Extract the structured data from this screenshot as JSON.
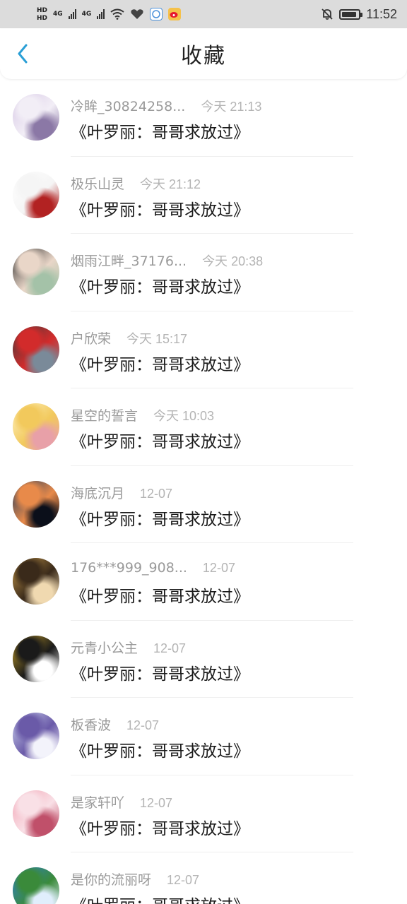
{
  "status_bar": {
    "hd1": "HD",
    "hd2": "HD",
    "net1": "4G",
    "net2": "4G",
    "time": "11:52",
    "icons": [
      "hd-icon",
      "signal-icon",
      "wifi-icon",
      "heart-app-icon",
      "chat-app-icon",
      "weibo-icon",
      "mute-icon",
      "battery-icon"
    ],
    "battery_level": 0.9
  },
  "nav": {
    "title": "收藏",
    "back_icon": "chevron-left-icon",
    "accent": "#2a9fd6"
  },
  "favorites": [
    {
      "user": "冷眸_30824258...",
      "time": "今天 21:13",
      "content": "《叶罗丽：哥哥求放过》",
      "avatar": [
        "#d8c9e6",
        "#f2eef6",
        "#8b78a6"
      ]
    },
    {
      "user": "极乐山灵",
      "time": "今天 21:12",
      "content": "《叶罗丽：哥哥求放过》",
      "avatar": [
        "#ffffff",
        "#f5f5f5",
        "#b22222"
      ]
    },
    {
      "user": "烟雨江畔_37176...",
      "time": "今天 20:38",
      "content": "《叶罗丽：哥哥求放过》",
      "avatar": [
        "#2b2b2b",
        "#e9d6c8",
        "#a4c2a8"
      ]
    },
    {
      "user": "户欣荣",
      "time": "今天 15:17",
      "content": "《叶罗丽：哥哥求放过》",
      "avatar": [
        "#3b3b3b",
        "#d22b2b",
        "#7a8a99"
      ]
    },
    {
      "user": "星空的誓言",
      "time": "今天 10:03",
      "content": "《叶罗丽：哥哥求放过》",
      "avatar": [
        "#fff3c4",
        "#f2c95c",
        "#e8a0a8"
      ]
    },
    {
      "user": "海底沉月",
      "time": "12-07",
      "content": "《叶罗丽：哥哥求放过》",
      "avatar": [
        "#1c3a5e",
        "#e88a4a",
        "#0b0f1a"
      ]
    },
    {
      "user": "176***999_908...",
      "time": "12-07",
      "content": "《叶罗丽：哥哥求放过》",
      "avatar": [
        "#c79a4a",
        "#3a2a1a",
        "#f0d9b0"
      ]
    },
    {
      "user": "元青小公主",
      "time": "12-07",
      "content": "《叶罗丽：哥哥求放过》",
      "avatar": [
        "#c9a227",
        "#1a1a1a",
        "#ffffff"
      ]
    },
    {
      "user": "板香波",
      "time": "12-07",
      "content": "《叶罗丽：哥哥求放过》",
      "avatar": [
        "#cfd8f0",
        "#6a5aa8",
        "#f3f3fb"
      ]
    },
    {
      "user": "是家轩吖",
      "time": "12-07",
      "content": "《叶罗丽：哥哥求放过》",
      "avatar": [
        "#f2a6b6",
        "#f9e0e6",
        "#c0506a"
      ]
    },
    {
      "user": "是你的流丽呀",
      "time": "12-07",
      "content": "《叶罗丽：哥哥求放过》",
      "avatar": [
        "#2f7fd0",
        "#3a8a3a",
        "#e0eefc"
      ]
    }
  ]
}
